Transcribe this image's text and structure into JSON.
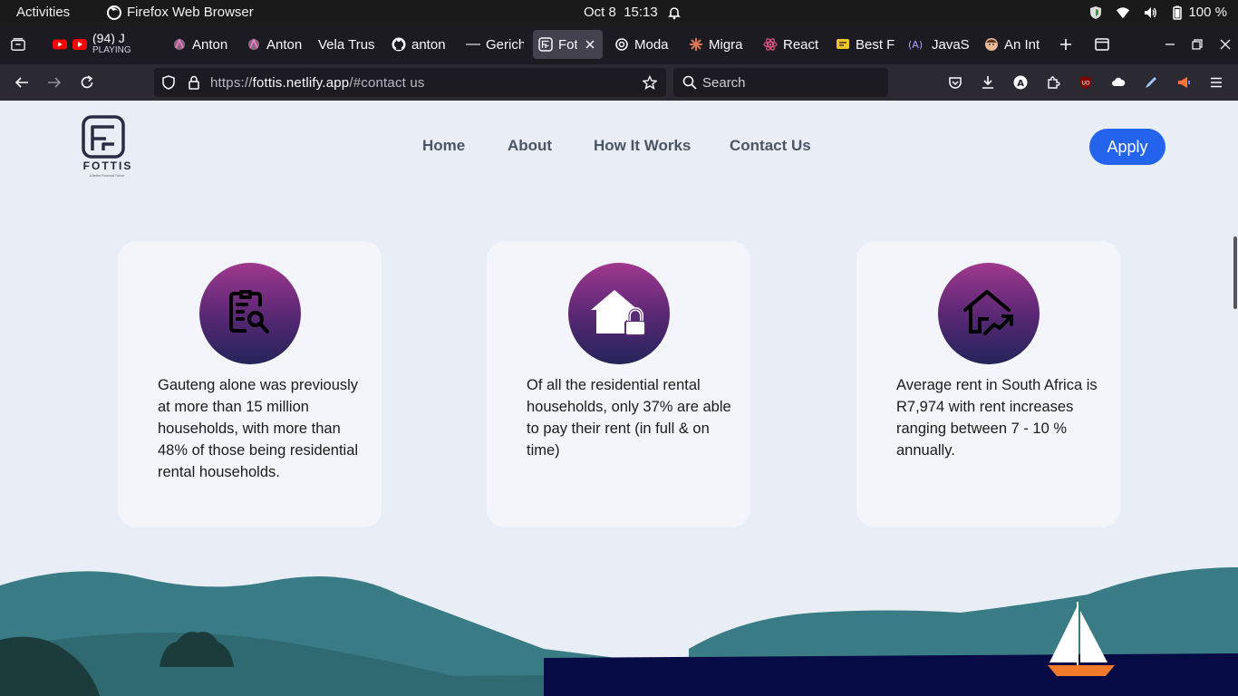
{
  "system_bar": {
    "activities": "Activities",
    "app_name": "Firefox Web Browser",
    "date": "Oct 8",
    "time": "15:13",
    "battery": "100 %"
  },
  "tabs": [
    {
      "title": "(94) J",
      "subtitle": "PLAYING",
      "icon": "youtube-icon"
    },
    {
      "title": "Anton",
      "icon": "anton-avatar-icon"
    },
    {
      "title": "Anton",
      "icon": "anton-avatar-icon"
    },
    {
      "title": "Vela Trus",
      "icon": "none"
    },
    {
      "title": "anton",
      "icon": "github-icon"
    },
    {
      "title": "Gerich",
      "icon": "gerich-icon"
    },
    {
      "title": "Fott",
      "icon": "fottis-icon",
      "active": true
    },
    {
      "title": "Moda",
      "icon": "openai-icon"
    },
    {
      "title": "Migra",
      "icon": "claude-icon"
    },
    {
      "title": "React",
      "icon": "react-icon"
    },
    {
      "title": "Best F",
      "icon": "yellow-icon"
    },
    {
      "title": "JavaS",
      "icon": "js-icon"
    },
    {
      "title": "An Int",
      "icon": "person-icon"
    }
  ],
  "navbar": {
    "url_scheme": "https://",
    "url_host": "fottis.netlify.app",
    "url_path": "/#contact us",
    "search_placeholder": "Search"
  },
  "site": {
    "logo_text": "FOTTIS",
    "logo_tagline": "A Better Financial Future",
    "nav": [
      {
        "label": "Home"
      },
      {
        "label": "About"
      },
      {
        "label": "How It Works"
      },
      {
        "label": "Contact Us"
      }
    ],
    "apply_label": "Apply"
  },
  "cards": [
    {
      "icon": "clipboard-search-icon",
      "text": "Gauteng alone was previously at more than 15 million households, with more than 48% of those being residential rental households."
    },
    {
      "icon": "house-lock-icon",
      "text": "Of all the residential rental households, only 37% are able to pay their rent (in full & on time)"
    },
    {
      "icon": "house-trend-up-icon",
      "text": "Average rent in South Africa is R7,974 with rent increases ranging between 7 - 10 % annually."
    }
  ],
  "colors": {
    "apply_button": "#2463eb",
    "icon_gradient_top": "#a0388e",
    "icon_gradient_bottom": "#24245a",
    "page_background": "#e8edf6",
    "card_background": "#f3f5fa"
  }
}
